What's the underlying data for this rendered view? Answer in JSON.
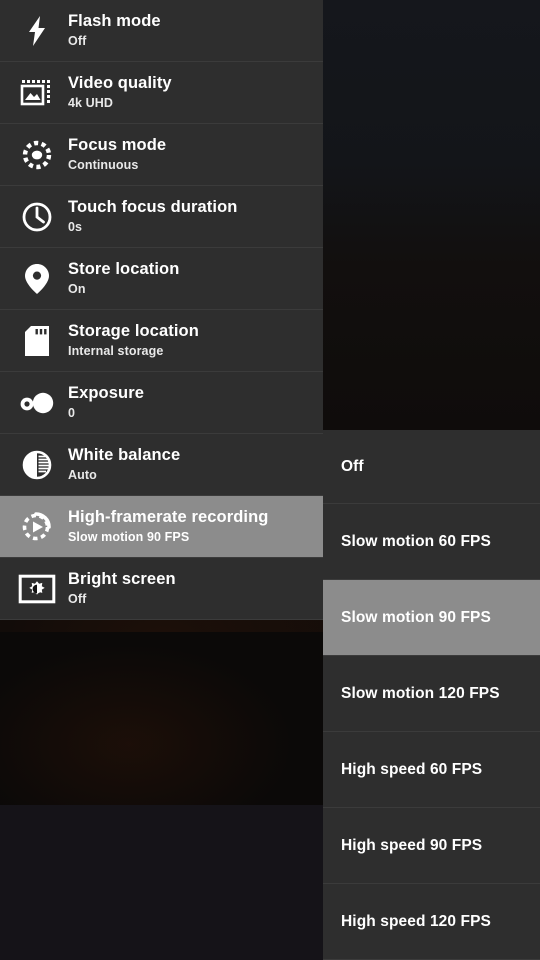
{
  "app": {
    "name": "Camera settings",
    "highlight_color": "#8c8c8c",
    "panel_color": "#2e2e2e",
    "divider_color": "#3b3b3b",
    "text_color": "#ffffff"
  },
  "settings": {
    "items": [
      {
        "icon": "flash-icon",
        "title": "Flash mode",
        "value": "Off",
        "selected": false
      },
      {
        "icon": "video-quality-icon",
        "title": "Video quality",
        "value": "4k UHD",
        "selected": false
      },
      {
        "icon": "focus-mode-icon",
        "title": "Focus mode",
        "value": "Continuous",
        "selected": false
      },
      {
        "icon": "clock-icon",
        "title": "Touch focus duration",
        "value": "0s",
        "selected": false
      },
      {
        "icon": "location-pin-icon",
        "title": "Store location",
        "value": "On",
        "selected": false
      },
      {
        "icon": "sd-card-icon",
        "title": "Storage location",
        "value": "Internal storage",
        "selected": false
      },
      {
        "icon": "exposure-icon",
        "title": "Exposure",
        "value": "0",
        "selected": false
      },
      {
        "icon": "white-balance-icon",
        "title": "White balance",
        "value": "Auto",
        "selected": false
      },
      {
        "icon": "high-framerate-icon",
        "title": "High-framerate recording",
        "value": "Slow motion 90 FPS",
        "selected": true
      },
      {
        "icon": "bright-screen-icon",
        "title": "Bright screen",
        "value": "Off",
        "selected": false
      }
    ]
  },
  "options": {
    "title": "High-framerate recording",
    "items": [
      {
        "label": "Off",
        "selected": false
      },
      {
        "label": "Slow motion 60 FPS",
        "selected": false
      },
      {
        "label": "Slow motion 90 FPS",
        "selected": true
      },
      {
        "label": "Slow motion 120 FPS",
        "selected": false
      },
      {
        "label": "High speed 60 FPS",
        "selected": false
      },
      {
        "label": "High speed 90 FPS",
        "selected": false
      },
      {
        "label": "High speed 120 FPS",
        "selected": false
      }
    ]
  }
}
